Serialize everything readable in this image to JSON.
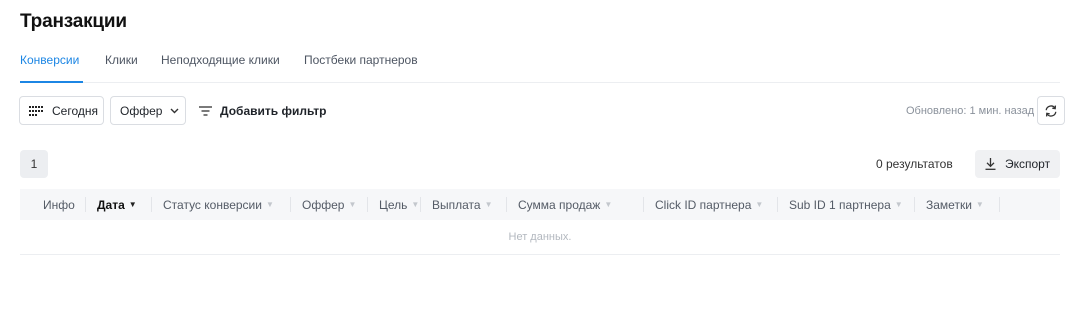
{
  "page_title": "Транзакции",
  "tabs": [
    {
      "label": "Конверсии",
      "active": true
    },
    {
      "label": "Клики",
      "active": false
    },
    {
      "label": "Неподходящие клики",
      "active": false
    },
    {
      "label": "Постбеки партнеров",
      "active": false
    }
  ],
  "filters": {
    "date_button": "Сегодня",
    "offer_dropdown": "Оффер",
    "add_filter": "Добавить фильтр"
  },
  "updated_text": "Обновлено: 1 мин. назад",
  "pagination": {
    "current_page": "1"
  },
  "results_text": "0 результатов",
  "export_label": "Экспорт",
  "table": {
    "columns": [
      {
        "label": "Инфо",
        "sortable": false
      },
      {
        "label": "Дата",
        "sortable": true,
        "sorted": true
      },
      {
        "label": "Статус конверсии",
        "sortable": true
      },
      {
        "label": "Оффер",
        "sortable": true
      },
      {
        "label": "Цель",
        "sortable": true
      },
      {
        "label": "Выплата",
        "sortable": true
      },
      {
        "label": "Сумма продаж",
        "sortable": true
      },
      {
        "label": "Click ID партнера",
        "sortable": true
      },
      {
        "label": "Sub ID 1 партнера",
        "sortable": true
      },
      {
        "label": "Заметки",
        "sortable": true
      }
    ],
    "empty_text": "Нет данных."
  },
  "colors": {
    "accent": "#1c86e4",
    "header_bg": "#f6f7f9",
    "border": "#dadde2"
  }
}
